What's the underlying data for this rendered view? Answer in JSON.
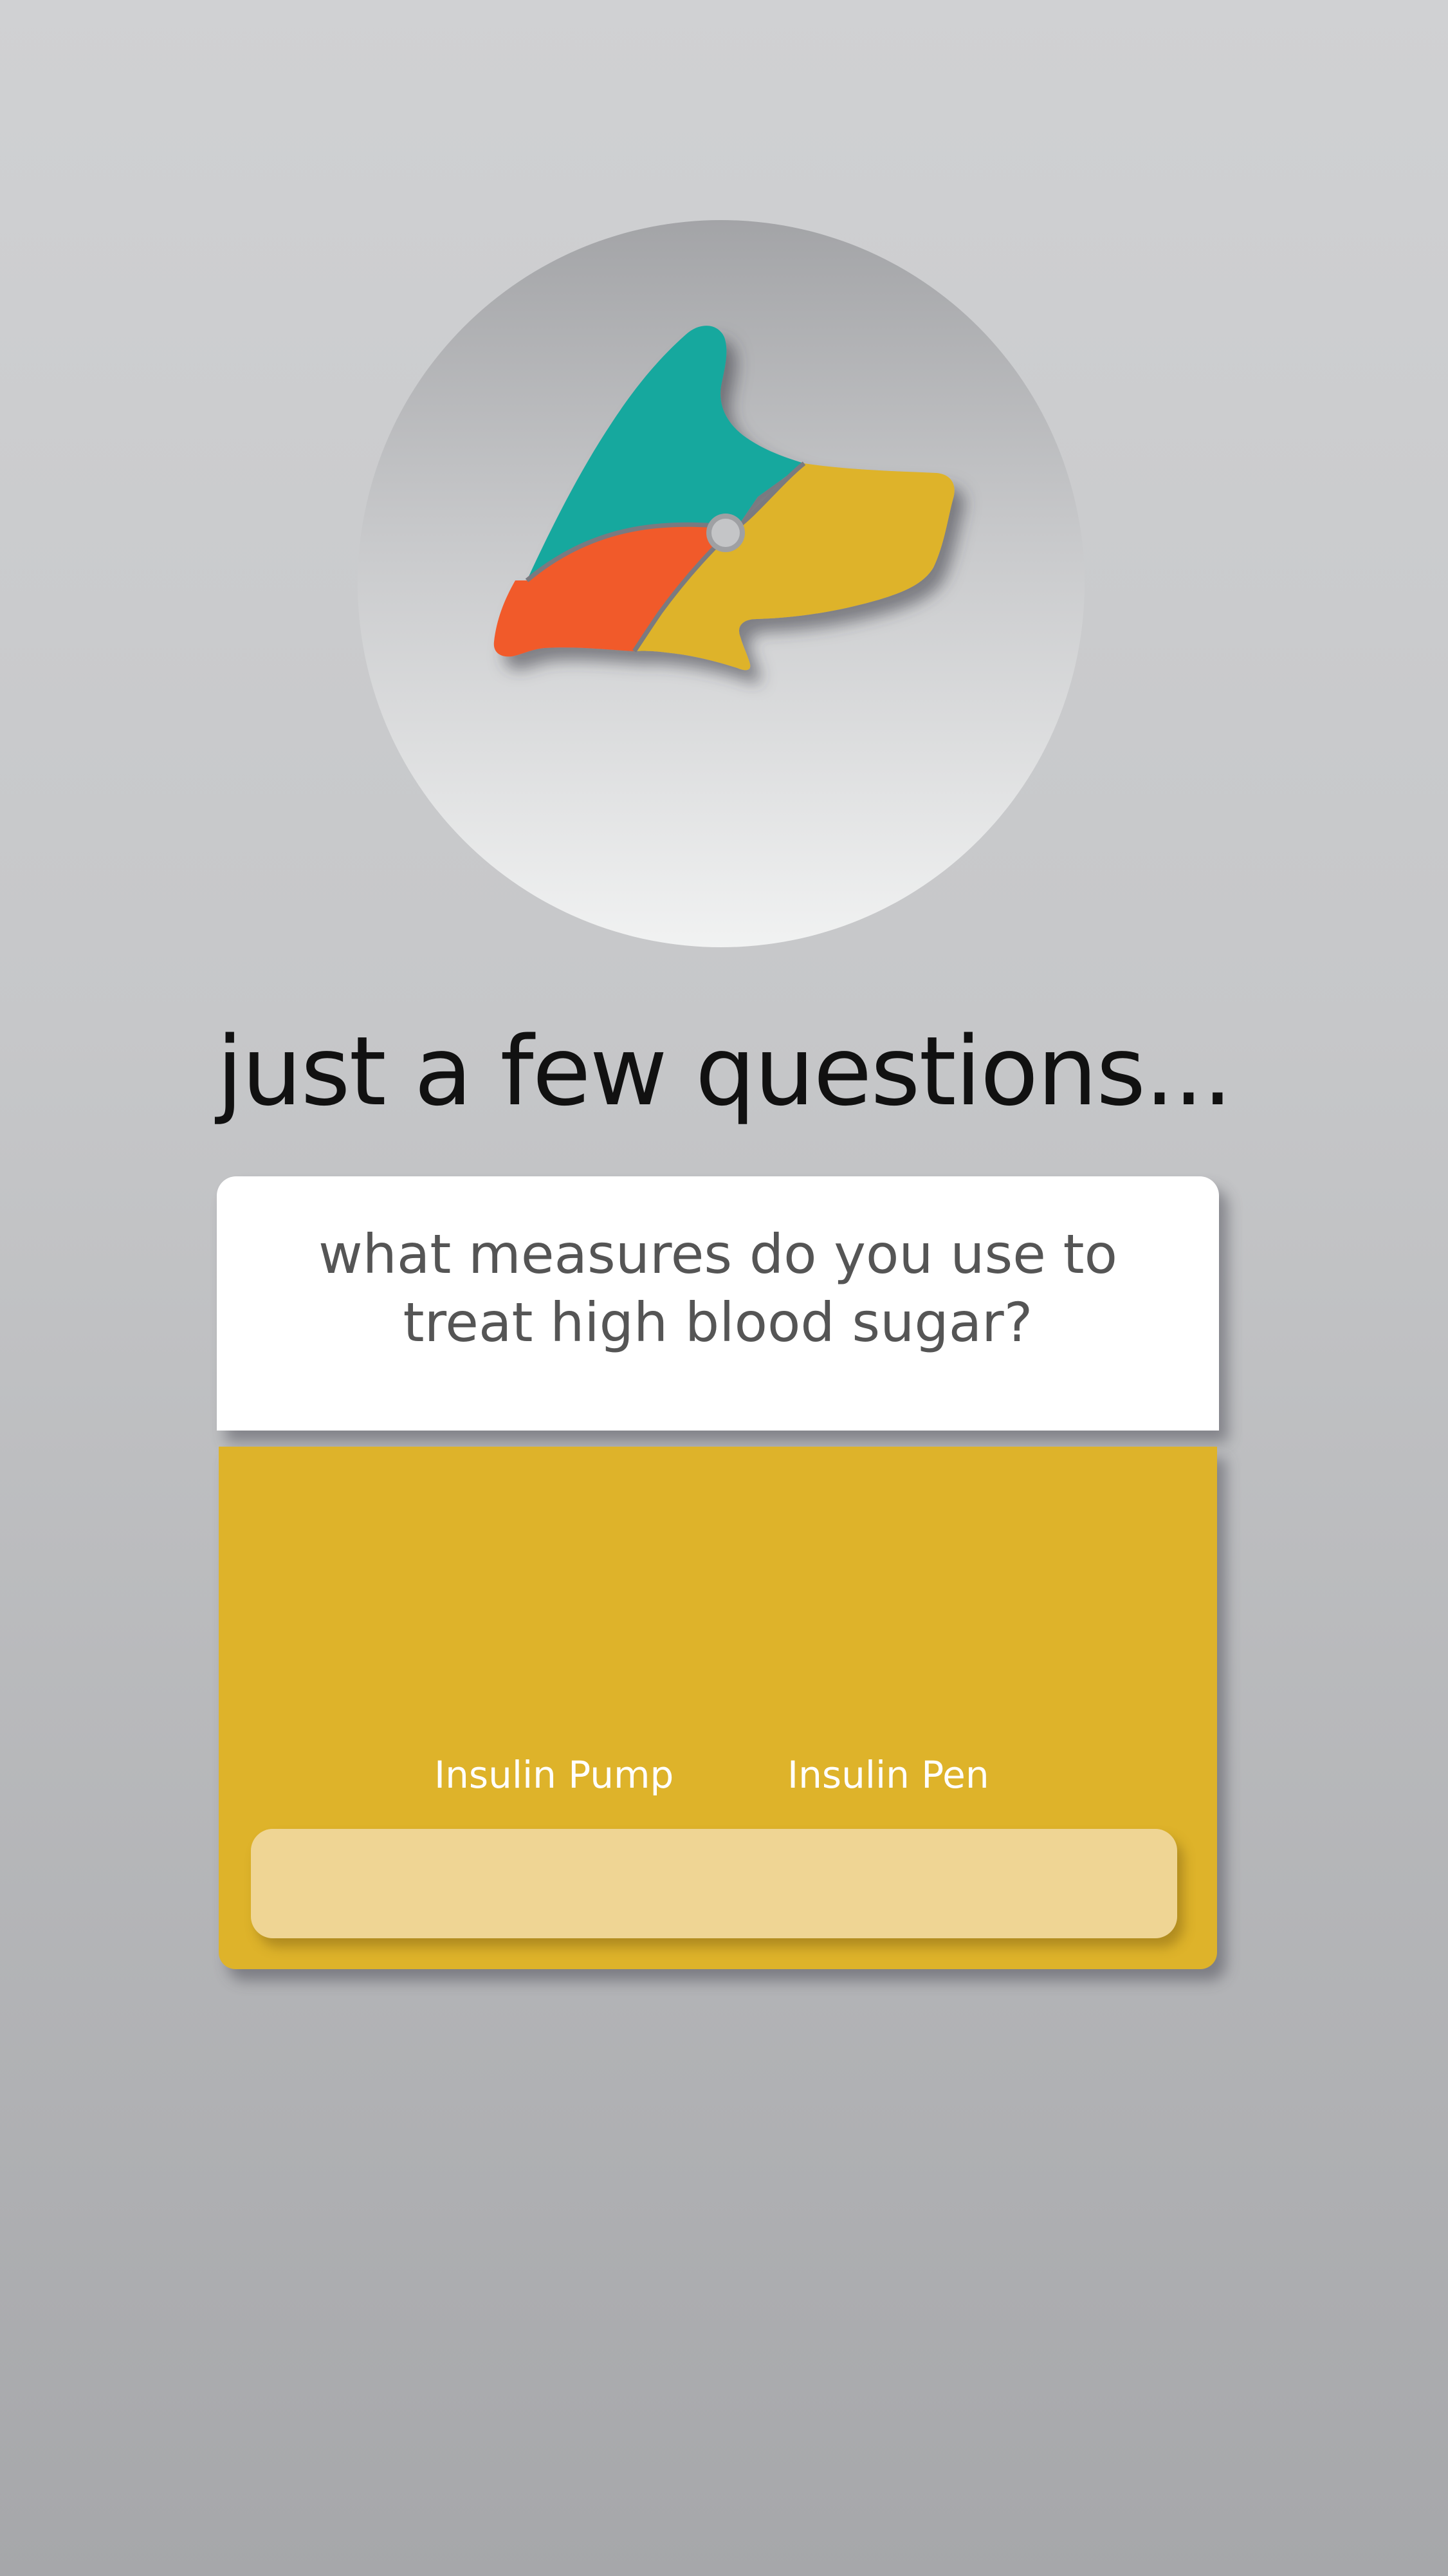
{
  "app": {
    "heading": "just a few questions..."
  },
  "logo": {
    "icon": "dog-head-logo-icon",
    "colors": {
      "teal": "#13a89e",
      "orange": "#f15a2b",
      "gold": "#deb32a",
      "circle_top": "#a3a4a7",
      "circle_bottom": "#f1f2f2"
    }
  },
  "question": {
    "text": "what measures do you use to treat high blood sugar?"
  },
  "answers": {
    "options": [
      {
        "label": "Insulin Pump"
      },
      {
        "label": "Insulin Pen"
      }
    ],
    "panel_color": "#deb32a",
    "slider_color": "#efd594"
  }
}
